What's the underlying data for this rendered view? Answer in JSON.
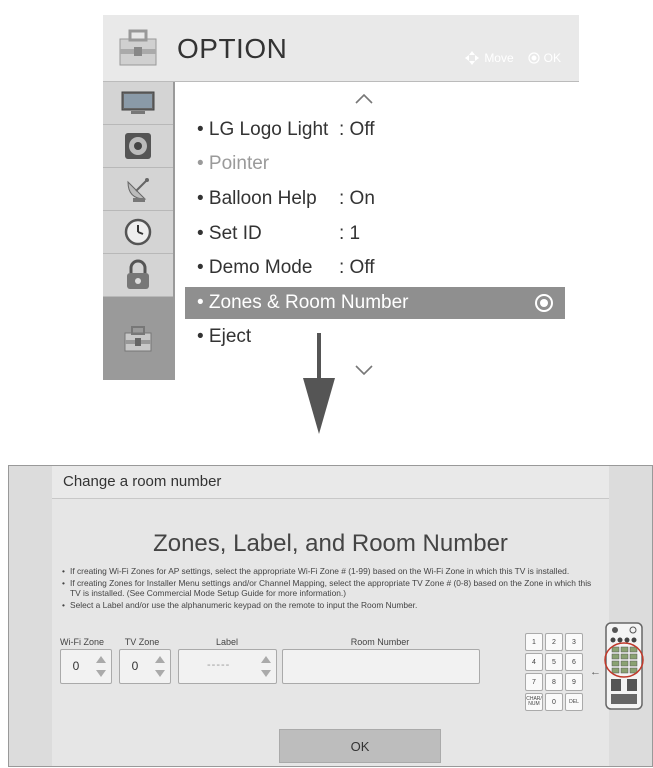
{
  "menu": {
    "title": "OPTION",
    "hint_move": "Move",
    "hint_ok": "OK",
    "side_icons": [
      "tv-picture-icon",
      "speaker-icon",
      "satellite-icon",
      "clock-icon",
      "lock-icon",
      "toolbox-icon"
    ],
    "items": [
      {
        "label": "• LG Logo Light",
        "value": ": Off"
      },
      {
        "label": "• Pointer",
        "value": ""
      },
      {
        "label": "• Balloon Help",
        "value": ": On"
      },
      {
        "label": "• Set ID",
        "value": ": 1"
      },
      {
        "label": "• Demo Mode",
        "value": ": Off"
      },
      {
        "label": "• Zones & Room Number",
        "value": ""
      },
      {
        "label": "• Eject",
        "value": ""
      }
    ],
    "selected_index": 5,
    "dimmed_index": 1
  },
  "dialog": {
    "title": "Change a room number",
    "heading": "Zones, Label, and Room Number",
    "bullets": [
      "If creating Wi-Fi Zones for AP settings, select the appropriate Wi-Fi Zone # (1-99) based on the Wi-Fi Zone in which this TV is installed.",
      "If creating Zones for Installer Menu settings and/or Channel Mapping, select the appropriate TV Zone # (0-8) based on the Zone in which this TV is installed. (See Commercial Mode Setup Guide for more information.)",
      "Select a Label and/or use the alphanumeric keypad on the remote to input the Room Number."
    ],
    "wifi_zone": {
      "label": "Wi-Fi Zone",
      "value": "0"
    },
    "tv_zone": {
      "label": "TV Zone",
      "value": "0"
    },
    "label_field": {
      "label": "Label",
      "value": "-----"
    },
    "room_number": {
      "label": "Room Number",
      "value": ""
    },
    "keypad": [
      "1",
      "2",
      "3",
      "4",
      "5",
      "6",
      "7",
      "8",
      "9",
      "CHAR/\nNUM",
      "0",
      "DEL"
    ],
    "ok_label": "OK"
  }
}
